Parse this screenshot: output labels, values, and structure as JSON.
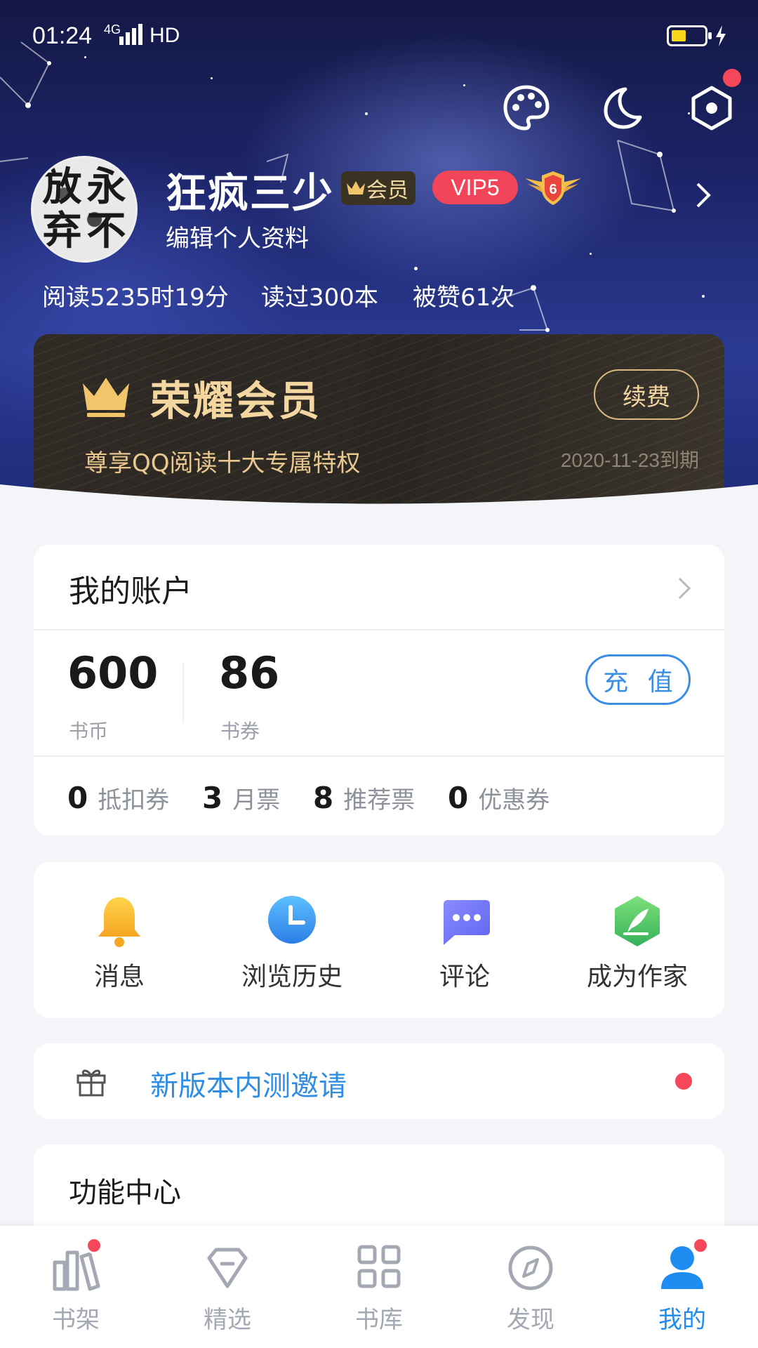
{
  "status_bar": {
    "time": "01:24",
    "network": "4G",
    "hd": "HD",
    "battery_color": "#f9d71c"
  },
  "header": {
    "icons": [
      "palette-icon",
      "moon-icon",
      "settings-hexagon-icon"
    ],
    "avatar_chars": [
      "放",
      "永",
      "弃",
      "不"
    ],
    "username": "狂疯三少",
    "member_badge": "会员",
    "vip_badge": "VIP5",
    "level_badge": "6",
    "edit_profile": "编辑个人资料",
    "stats": {
      "read_time": "阅读5235时19分",
      "books_read": "读过300本",
      "likes": "被赞61次"
    }
  },
  "member_card": {
    "title": "荣耀会员",
    "subtitle": "尊享QQ阅读十大专属特权",
    "expire": "2020-11-23到期",
    "renew_label": "续费"
  },
  "account": {
    "title": "我的账户",
    "coins_value": "600",
    "coins_label": "书币",
    "vouchers_value": "86",
    "vouchers_label": "书券",
    "recharge_label": "充 值",
    "tickets": [
      {
        "value": "0",
        "label": "抵扣券"
      },
      {
        "value": "3",
        "label": "月票"
      },
      {
        "value": "8",
        "label": "推荐票"
      },
      {
        "value": "0",
        "label": "优惠券"
      }
    ]
  },
  "shortcuts": [
    {
      "label": "消息",
      "icon": "bell-icon"
    },
    {
      "label": "浏览历史",
      "icon": "clock-icon"
    },
    {
      "label": "评论",
      "icon": "chat-bubble-icon"
    },
    {
      "label": "成为作家",
      "icon": "quill-icon"
    }
  ],
  "invite": {
    "label": "新版本内测邀请",
    "icon": "gift-icon"
  },
  "function_center": {
    "title": "功能中心"
  },
  "bottom_nav": [
    {
      "label": "书架",
      "icon": "bookshelf-icon",
      "badge": true
    },
    {
      "label": "精选",
      "icon": "diamond-icon",
      "badge": false
    },
    {
      "label": "书库",
      "icon": "grid-icon",
      "badge": false
    },
    {
      "label": "发现",
      "icon": "compass-icon",
      "badge": false
    },
    {
      "label": "我的",
      "icon": "user-icon",
      "badge": true,
      "active": true
    }
  ],
  "colors": {
    "accent": "#1e8cf0",
    "link": "#2f8de4",
    "badge_red": "#f5465a",
    "vip_red": "#f2455a",
    "gold": "#f3d6a0"
  }
}
